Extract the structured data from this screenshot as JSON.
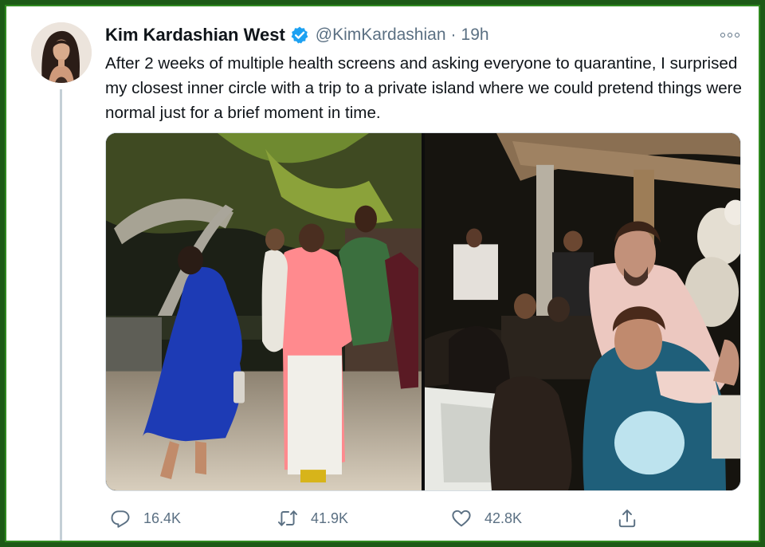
{
  "tweet": {
    "author_name": "Kim Kardashian West",
    "handle": "@KimKardashian",
    "separator": "·",
    "time": "19h",
    "text": "After 2 weeks of multiple health screens and asking everyone to quarantine, I surprised my closest inner circle with a trip to a private island where we could pretend things were normal just for a brief moment in time.",
    "verified": true
  },
  "actions": {
    "replies": "16.4K",
    "retweets": "41.9K",
    "likes": "42.8K"
  },
  "icons": {
    "verified": "verified-badge-icon",
    "more": "more-options-icon",
    "reply": "reply-icon",
    "retweet": "retweet-icon",
    "like": "heart-icon",
    "share": "share-icon"
  },
  "colors": {
    "frame": "#1d5a16",
    "verified_blue": "#1da1f2",
    "secondary_text": "#5b7083",
    "primary_text": "#0f1419"
  }
}
